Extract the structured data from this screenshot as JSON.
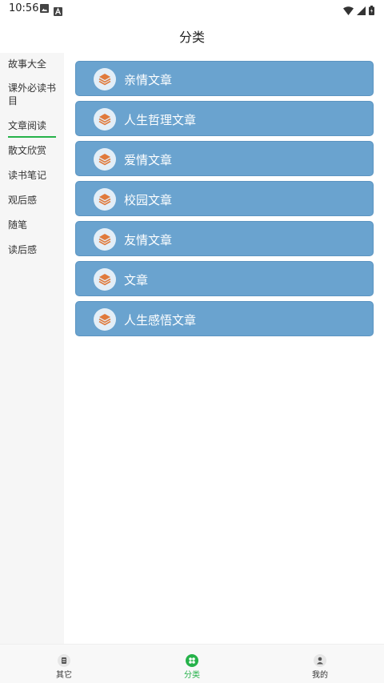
{
  "status_bar": {
    "time": "10:56"
  },
  "header": {
    "title": "分类"
  },
  "sidebar": {
    "items": [
      {
        "label": "故事大全"
      },
      {
        "label": "课外必读书目"
      },
      {
        "label": "文章阅读"
      },
      {
        "label": "散文欣赏"
      },
      {
        "label": "读书笔记"
      },
      {
        "label": "观后感"
      },
      {
        "label": "随笔"
      },
      {
        "label": "读后感"
      }
    ],
    "active_index": 2
  },
  "categories": [
    {
      "label": "亲情文章",
      "icon": "layers-icon"
    },
    {
      "label": "人生哲理文章",
      "icon": "layers-icon"
    },
    {
      "label": "爱情文章",
      "icon": "layers-icon"
    },
    {
      "label": "校园文章",
      "icon": "layers-icon"
    },
    {
      "label": "友情文章",
      "icon": "layers-icon"
    },
    {
      "label": "文章",
      "icon": "layers-icon"
    },
    {
      "label": "人生感悟文章",
      "icon": "layers-icon"
    }
  ],
  "tabbar": {
    "tabs": [
      {
        "label": "其它",
        "icon": "document-icon"
      },
      {
        "label": "分类",
        "icon": "grid-icon"
      },
      {
        "label": "我的",
        "icon": "user-icon"
      }
    ],
    "active_index": 1
  },
  "colors": {
    "accent": "#26b24a",
    "card": "#6aa3cf",
    "icon_orange": "#e07a3c"
  }
}
